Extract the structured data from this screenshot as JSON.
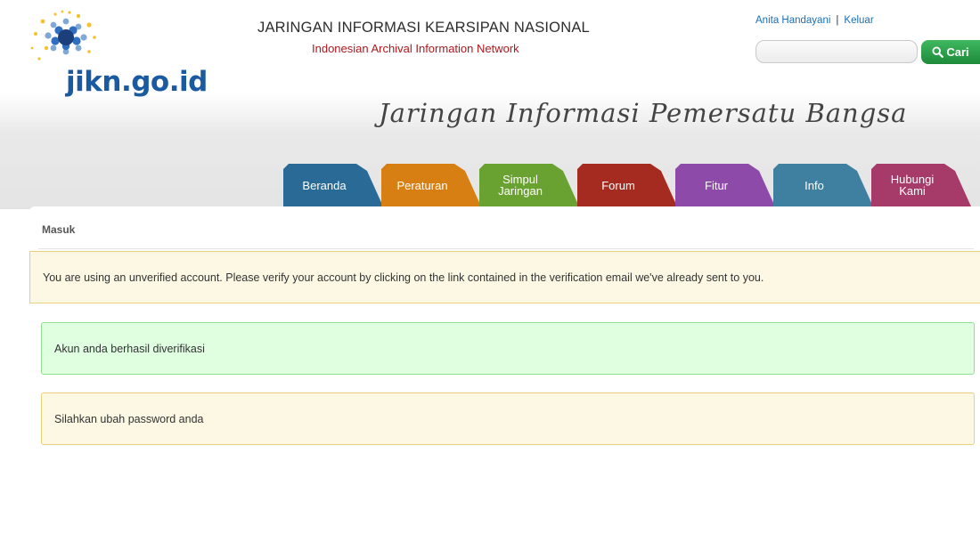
{
  "logo": {
    "text": "jikn.go.id",
    "badge": "JIKN"
  },
  "site": {
    "title": "JARINGAN INFORMASI KEARSIPAN NASIONAL",
    "subtitle": "Indonesian Archival Information Network",
    "tagline": "Jaringan Informasi Pemersatu Bangsa"
  },
  "user": {
    "name": "Anita Handayani",
    "separator": "|",
    "logout": "Keluar"
  },
  "search": {
    "placeholder": "",
    "button_label": "Cari",
    "icon": "search-icon"
  },
  "nav": {
    "tabs": [
      {
        "label": "Beranda",
        "color": "#2a6a96"
      },
      {
        "label": "Peraturan",
        "color": "#d77f12"
      },
      {
        "label": "Simpul Jaringan",
        "color": "#6aa232"
      },
      {
        "label": "Forum",
        "color": "#a52a1f"
      },
      {
        "label": "Fitur",
        "color": "#8d4aa8"
      },
      {
        "label": "Info",
        "color": "#3f7fa0"
      },
      {
        "label": "Hubungi Kami",
        "color": "#a63a68"
      }
    ]
  },
  "main": {
    "breadcrumb": "Masuk",
    "alerts": {
      "unverified": "You are using an unverified account. Please verify your account by clicking on the link contained in the verification email we've already sent to you.",
      "success": "Akun anda berhasil diverifikasi",
      "password": "Silahkan ubah password anda"
    }
  },
  "colors": {
    "brand_blue": "#1a5aa0",
    "subtitle_red": "#b0181d",
    "search_green": "#2ea24d"
  }
}
